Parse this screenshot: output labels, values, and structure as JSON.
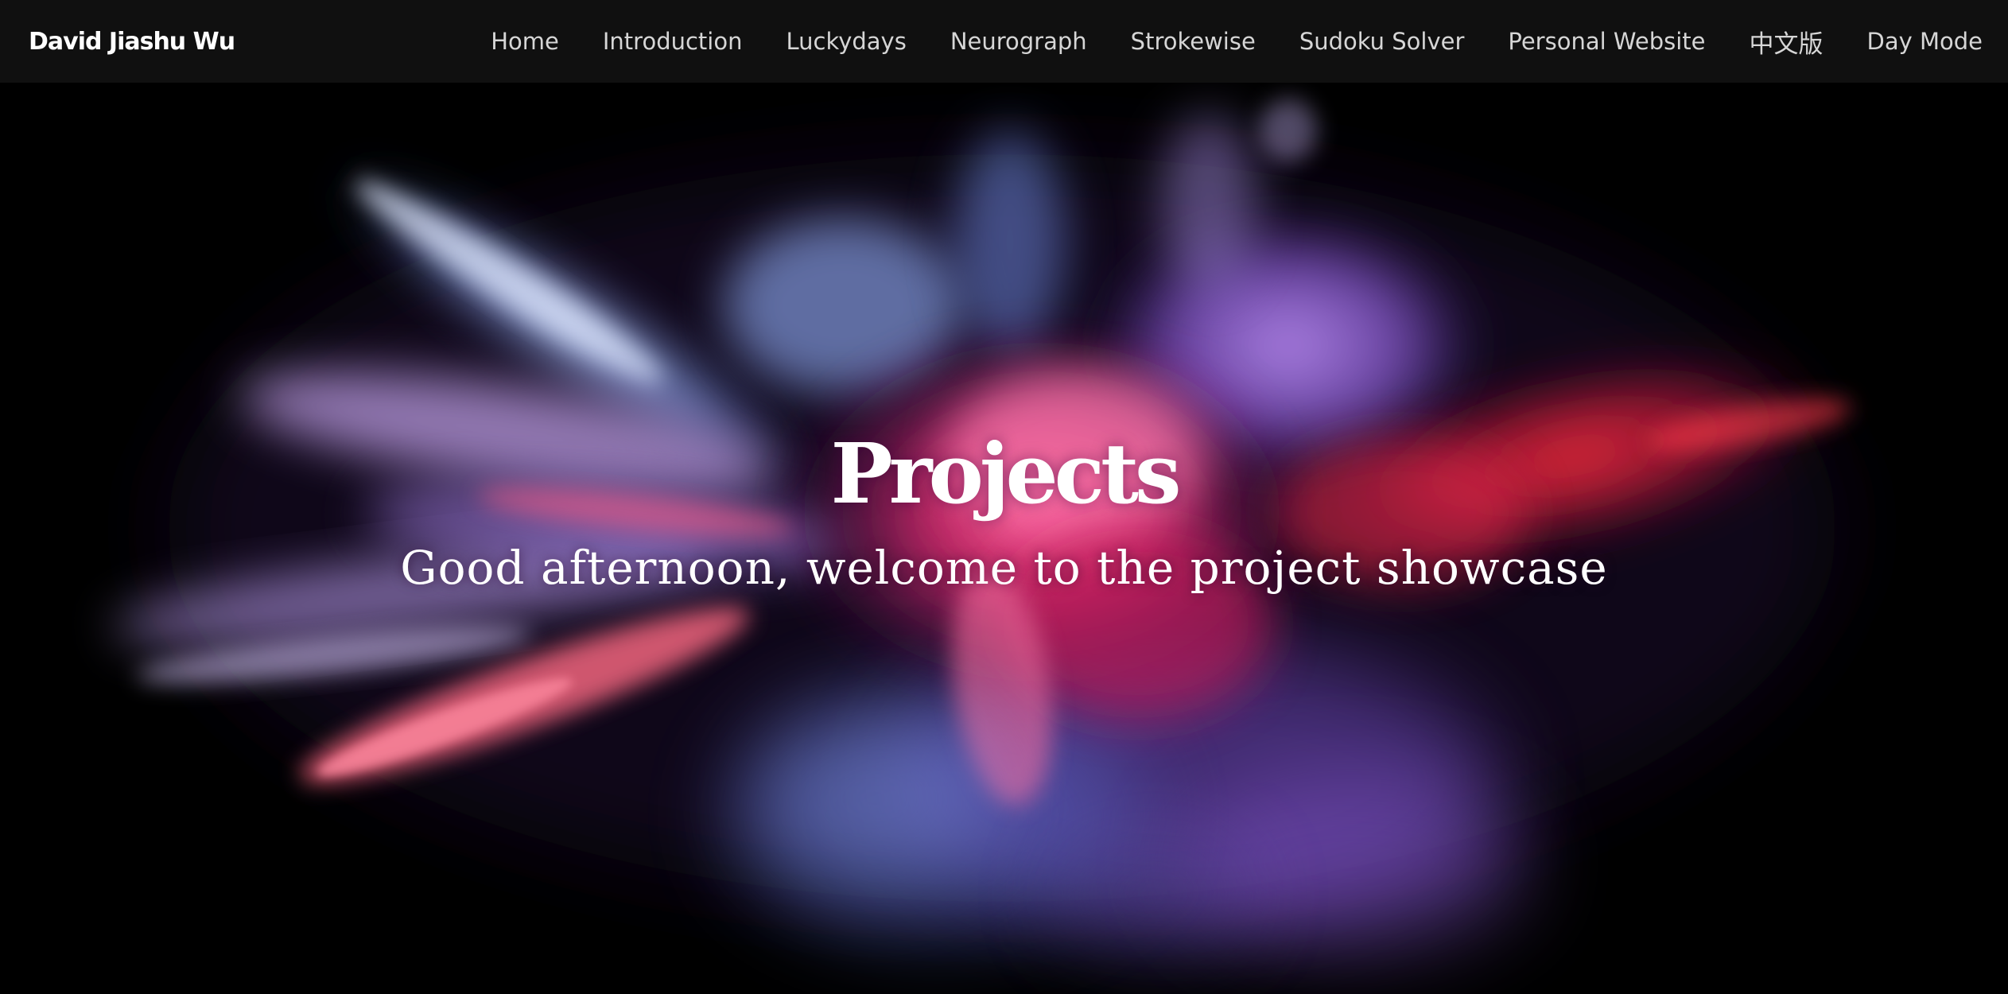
{
  "navbar": {
    "brand": "David Jiashu Wu",
    "links": [
      {
        "label": "Home"
      },
      {
        "label": "Introduction"
      },
      {
        "label": "Luckydays"
      },
      {
        "label": "Neurograph"
      },
      {
        "label": "Strokewise"
      },
      {
        "label": "Sudoku Solver"
      },
      {
        "label": "Personal Website"
      },
      {
        "label": "中文版"
      },
      {
        "label": "Day Mode"
      }
    ]
  },
  "hero": {
    "title": "Projects",
    "subtitle": "Good afternoon, welcome to the project showcase",
    "background_image": "colorful-powder-explosion"
  },
  "colors": {
    "navbar_bg": "#101010",
    "page_bg": "#000000",
    "nav_text": "#d6d6d6",
    "hero_text": "#ffffff",
    "powder_blue": "#9fb6f2",
    "powder_violet": "#9a6fe0",
    "powder_pink": "#e8508e",
    "powder_red": "#e02a3a"
  }
}
